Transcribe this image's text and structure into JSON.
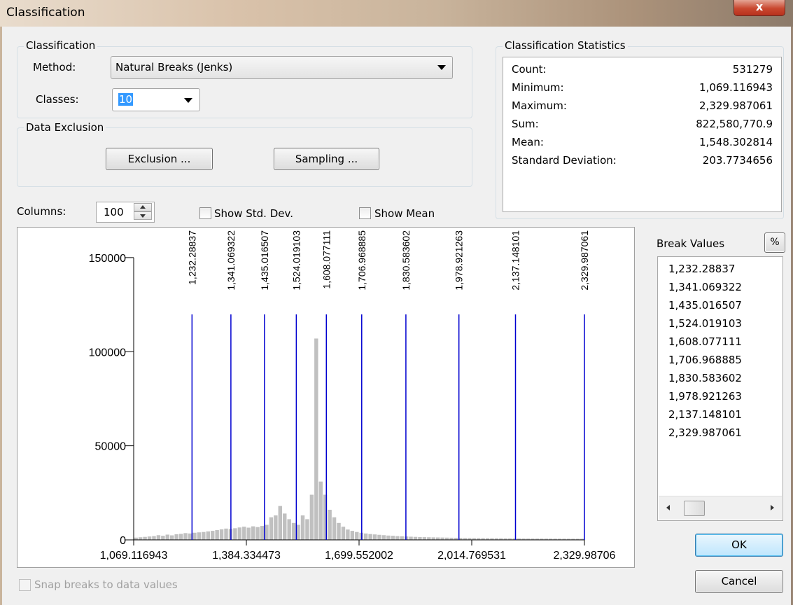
{
  "window": {
    "title": "Classification",
    "close_glyph": "x"
  },
  "classification": {
    "group_label": "Classification",
    "method_label": "Method:",
    "method_value": "Natural Breaks (Jenks)",
    "classes_label": "Classes:",
    "classes_value": "10"
  },
  "data_exclusion": {
    "group_label": "Data Exclusion",
    "exclusion_button": "Exclusion ...",
    "sampling_button": "Sampling ..."
  },
  "statistics": {
    "group_label": "Classification Statistics",
    "rows": [
      {
        "key": "Count:",
        "value": "531279"
      },
      {
        "key": "Minimum:",
        "value": "1,069.116943"
      },
      {
        "key": "Maximum:",
        "value": "2,329.987061"
      },
      {
        "key": "Sum:",
        "value": "822,580,770.9"
      },
      {
        "key": "Mean:",
        "value": "1,548.302814"
      },
      {
        "key": "Standard Deviation:",
        "value": "203.7734656"
      }
    ]
  },
  "controls": {
    "columns_label": "Columns:",
    "columns_value": "100",
    "show_std_dev": "Show Std. Dev.",
    "show_mean": "Show Mean",
    "snap_breaks": "Snap breaks to data values"
  },
  "break_values": {
    "label": "Break Values",
    "percent_button": "%",
    "items": [
      "1,232.28837",
      "1,341.069322",
      "1,435.016507",
      "1,524.019103",
      "1,608.077111",
      "1,706.968885",
      "1,830.583602",
      "1,978.921263",
      "2,137.148101",
      "2,329.987061"
    ]
  },
  "buttons": {
    "ok": "OK",
    "cancel": "Cancel"
  },
  "colors": {
    "break_line": "#0000d0",
    "histogram_bar": "#c0c0c0"
  },
  "chart_data": {
    "type": "bar",
    "x_range": [
      1069.116943,
      2329.987061
    ],
    "ylim": [
      0,
      160000
    ],
    "y_ticks": [
      "150000",
      "100000",
      "50000",
      "0"
    ],
    "y_tick_values": [
      150000,
      100000,
      50000,
      0
    ],
    "x_tick_labels": [
      "1,069.116943",
      "1,384.334473",
      "1,699.552002",
      "2,014.769531",
      "2,329.98706"
    ],
    "x_tick_values": [
      1069.116943,
      1384.334473,
      1699.552002,
      2014.769531,
      2329.98706
    ],
    "break_values": [
      1232.28837,
      1341.069322,
      1435.016507,
      1524.019103,
      1608.077111,
      1706.968885,
      1830.583602,
      1978.921263,
      2137.148101,
      2329.987061
    ],
    "break_labels": [
      "1,232.28837",
      "1,341.069322",
      "1,435.016507",
      "1,524.019103",
      "1,608.077111",
      "1,706.968885",
      "1,830.583602",
      "1,978.921263",
      "2,137.148101",
      "2,329.987061"
    ],
    "columns": 100,
    "bin_counts": [
      1200,
      1400,
      1600,
      1800,
      2000,
      2500,
      2200,
      2800,
      2400,
      3000,
      3200,
      3600,
      3400,
      3800,
      4000,
      4200,
      4500,
      4800,
      5200,
      5600,
      6000,
      5800,
      6200,
      6600,
      7000,
      6500,
      7200,
      6800,
      7400,
      8000,
      12000,
      13000,
      18000,
      14000,
      11000,
      9000,
      8000,
      13000,
      11000,
      24000,
      107000,
      31000,
      24000,
      16000,
      12000,
      9000,
      7000,
      5500,
      4800,
      4200,
      3800,
      3400,
      3100,
      2900,
      2700,
      2500,
      2300,
      2200,
      2000,
      1900,
      1800,
      1700,
      1600,
      1500,
      1450,
      1400,
      1350,
      1300,
      1250,
      1200,
      1150,
      1100,
      1050,
      1000,
      980,
      950,
      920,
      900,
      880,
      860,
      840,
      820,
      800,
      780,
      760,
      740,
      720,
      700,
      690,
      680,
      670,
      660,
      650,
      640,
      630,
      620,
      610,
      600,
      590,
      580
    ]
  }
}
